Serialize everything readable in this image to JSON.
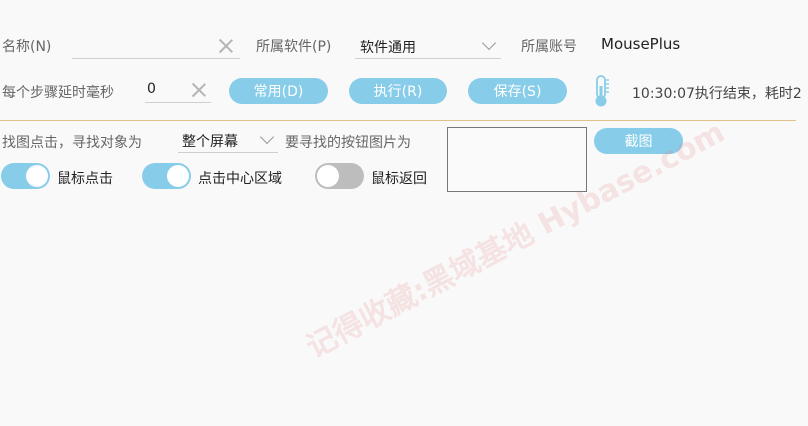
{
  "row1": {
    "name_label": "名称(N)",
    "name_value": "",
    "software_label": "所属软件(P)",
    "software_value": "软件通用",
    "account_label": "所属账号",
    "account_value": "MousePlus"
  },
  "row2": {
    "delay_label": "每个步骤延时毫秒",
    "delay_value": "0",
    "buttons": {
      "common": "常用(D)",
      "execute": "执行(R)",
      "save": "保存(S)"
    },
    "status_text": "10:30:07执行结束，耗时2"
  },
  "row3": {
    "find_label": "找图点击，寻找对象为",
    "target_value": "整个屏幕",
    "image_label": "要寻找的按钮图片为",
    "capture_button": "截图"
  },
  "row4": {
    "toggles": [
      {
        "label": "鼠标点击",
        "on": true
      },
      {
        "label": "点击中心区域",
        "on": true
      },
      {
        "label": "鼠标返回",
        "on": false
      }
    ]
  },
  "watermark_text": "记得收藏:黑域基地 Hybase.com",
  "colors": {
    "accent": "#87cde9",
    "divider": "#e2c08b",
    "toggle_off": "#bdbdbd"
  },
  "icons": {
    "thermometer": "thermometer-icon",
    "clear": "clear-icon",
    "dropdown": "chevron-down-icon"
  }
}
